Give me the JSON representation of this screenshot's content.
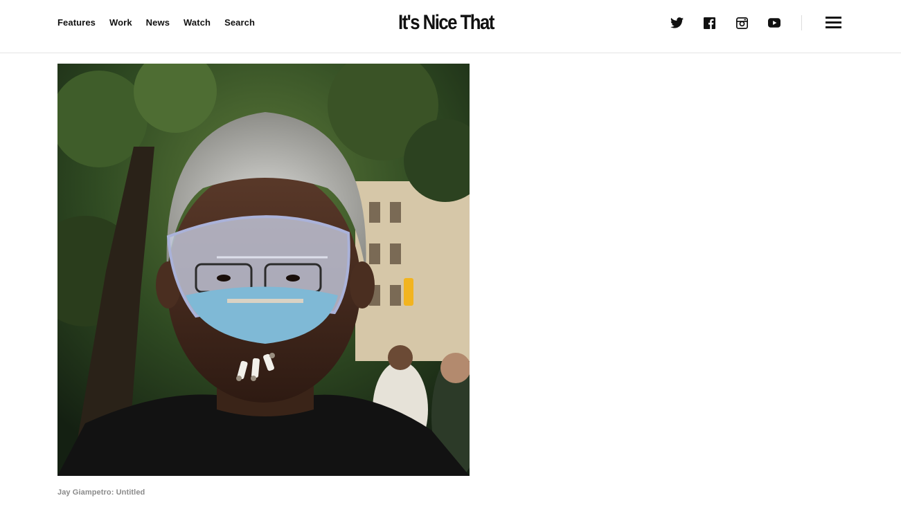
{
  "nav": {
    "items": [
      {
        "label": "Features"
      },
      {
        "label": "Work"
      },
      {
        "label": "News"
      },
      {
        "label": "Watch"
      },
      {
        "label": "Search"
      }
    ]
  },
  "logo": {
    "text": "It's Nice That"
  },
  "social": {
    "icons": [
      "twitter-icon",
      "facebook-icon",
      "instagram-icon",
      "youtube-icon"
    ]
  },
  "menu": {
    "icon": "hamburger-menu-icon"
  },
  "article": {
    "image_caption": "Jay Giampetro: Untitled"
  },
  "colors": {
    "text": "#111111",
    "caption": "#8a8a8a",
    "border": "#e4e4e4"
  }
}
